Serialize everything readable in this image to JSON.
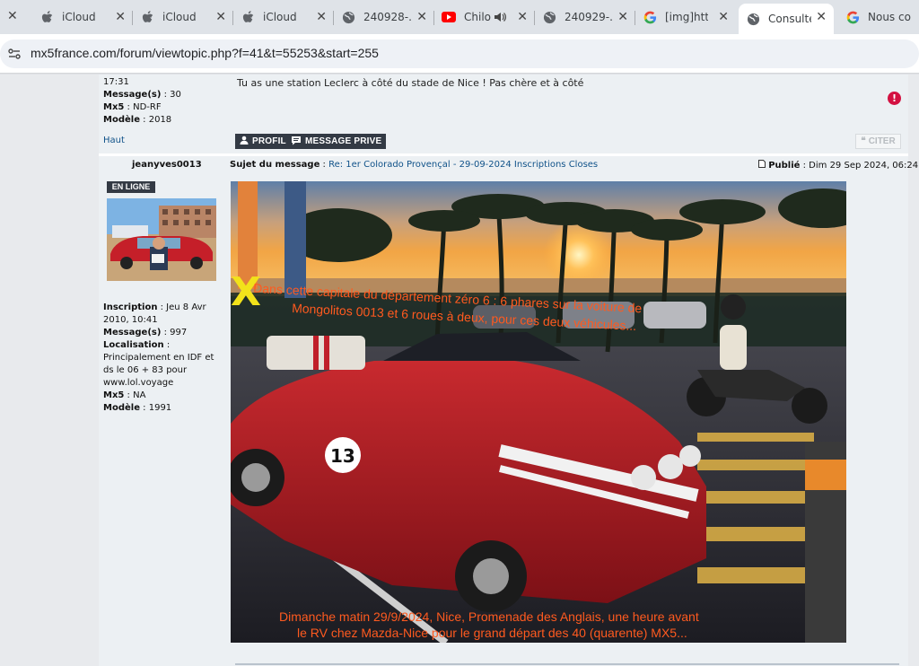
{
  "browser": {
    "tabs": [
      {
        "title": "iCloud",
        "icon": "apple-icon"
      },
      {
        "title": "iCloud",
        "icon": "apple-icon"
      },
      {
        "title": "iCloud",
        "icon": "apple-icon"
      },
      {
        "title": "240928-...",
        "icon": "globe-icon"
      },
      {
        "title": "Chilo",
        "icon": "youtube-icon"
      },
      {
        "title": "240929-...",
        "icon": "globe-icon"
      },
      {
        "title": "[img]http...",
        "icon": "google-icon"
      },
      {
        "title": "Consulte",
        "icon": "globe-icon",
        "active": true
      },
      {
        "title": "Nous co",
        "icon": "google-icon"
      }
    ],
    "url": "mx5france.com/forum/viewtopic.php?f=41&t=55253&start=255"
  },
  "prev_post": {
    "time": "17:31",
    "messages_label": "Message(s)",
    "messages_value": "30",
    "mx5_label": "Mx5",
    "mx5_value": "ND-RF",
    "model_label": "Modèle",
    "model_value": "2018",
    "text": "Tu as une station Leclerc à côté du stade de Nice ! Pas chère et à côté",
    "haut": "Haut",
    "profile_btn": "PROFIL",
    "pm_btn": "MESSAGE PRIVE",
    "quote_btn": "CITER"
  },
  "post": {
    "author": "jeanyves0013",
    "subject_label": "Sujet du message",
    "subject": "Re: 1er Colorado Provençal - 29-09-2024 Inscriptions Closes",
    "published_label": "Publié",
    "published": "Dim 29 Sep 2024, 06:24",
    "online": "EN LIGNE",
    "inscription_label": "Inscription",
    "inscription": "Jeu 8 Avr 2010, 10:41",
    "messages_label": "Message(s)",
    "messages": "997",
    "location_label": "Localisation",
    "location": "Principalement en IDF et ds le 06 + 83 pour www.lol.voyage",
    "mx5_label": "Mx5",
    "mx5": "NA",
    "model_label": "Modèle",
    "model": "1991"
  },
  "photo": {
    "mark": "X",
    "caption_top_1": "Dans cette capitale du département zéro 6 : 6 phares sur la voiture de",
    "caption_top_2": "Mongolitos 0013 et 6 roues à deux, pour ces deux véhicules...",
    "caption_bottom_1": "Dimanche matin 29/9/2024, Nice, Promenade des Anglais,  une heure avant",
    "caption_bottom_2": "le RV chez Mazda-Nice pour le grand départ des 40 (quarente) MX5...",
    "car_number": "13"
  },
  "colors": {
    "accent": "#105289",
    "caption": "#ff5a1f",
    "button_dark": "#333a44"
  }
}
